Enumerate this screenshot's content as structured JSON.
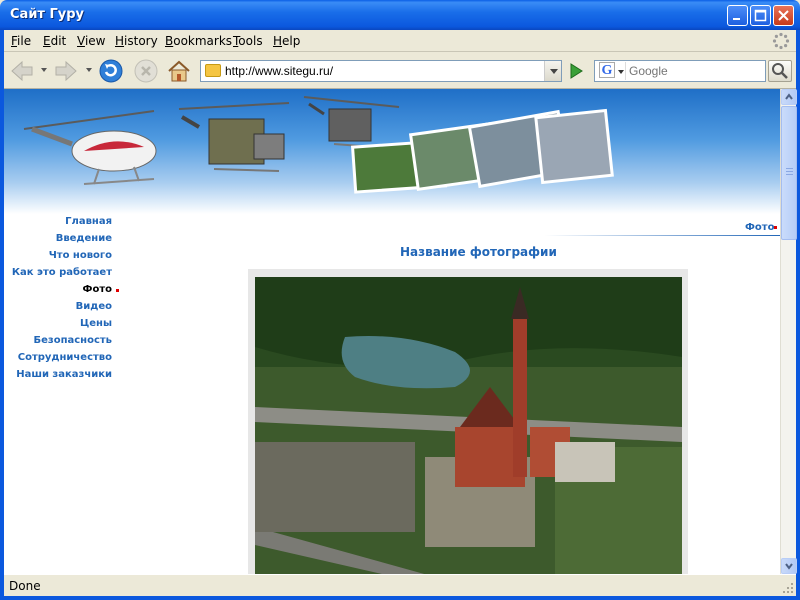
{
  "window": {
    "title": "Сайт Гуру"
  },
  "menu": [
    {
      "label": "File"
    },
    {
      "label": "Edit"
    },
    {
      "label": "View"
    },
    {
      "label": "History"
    },
    {
      "label": "Bookmarks"
    },
    {
      "label": "Tools"
    },
    {
      "label": "Help"
    }
  ],
  "toolbar": {
    "url": "http://www.sitegu.ru/",
    "search_placeholder": "Google"
  },
  "sidebar": {
    "items": [
      {
        "label": "Главная"
      },
      {
        "label": "Введение"
      },
      {
        "label": "Что нового"
      },
      {
        "label": "Как это работает"
      },
      {
        "label": "Фото"
      },
      {
        "label": "Видео"
      },
      {
        "label": "Цены"
      },
      {
        "label": "Безопасность"
      },
      {
        "label": "Сотрудничество"
      },
      {
        "label": "Наши заказчики"
      }
    ],
    "active_index": 4
  },
  "page": {
    "breadcrumb": "Фото",
    "photo_title": "Название фотографии"
  },
  "status": {
    "text": "Done"
  },
  "colors": {
    "link": "#2166b7",
    "accent_marker": "#e00000",
    "titlebar": "#0b58de"
  }
}
